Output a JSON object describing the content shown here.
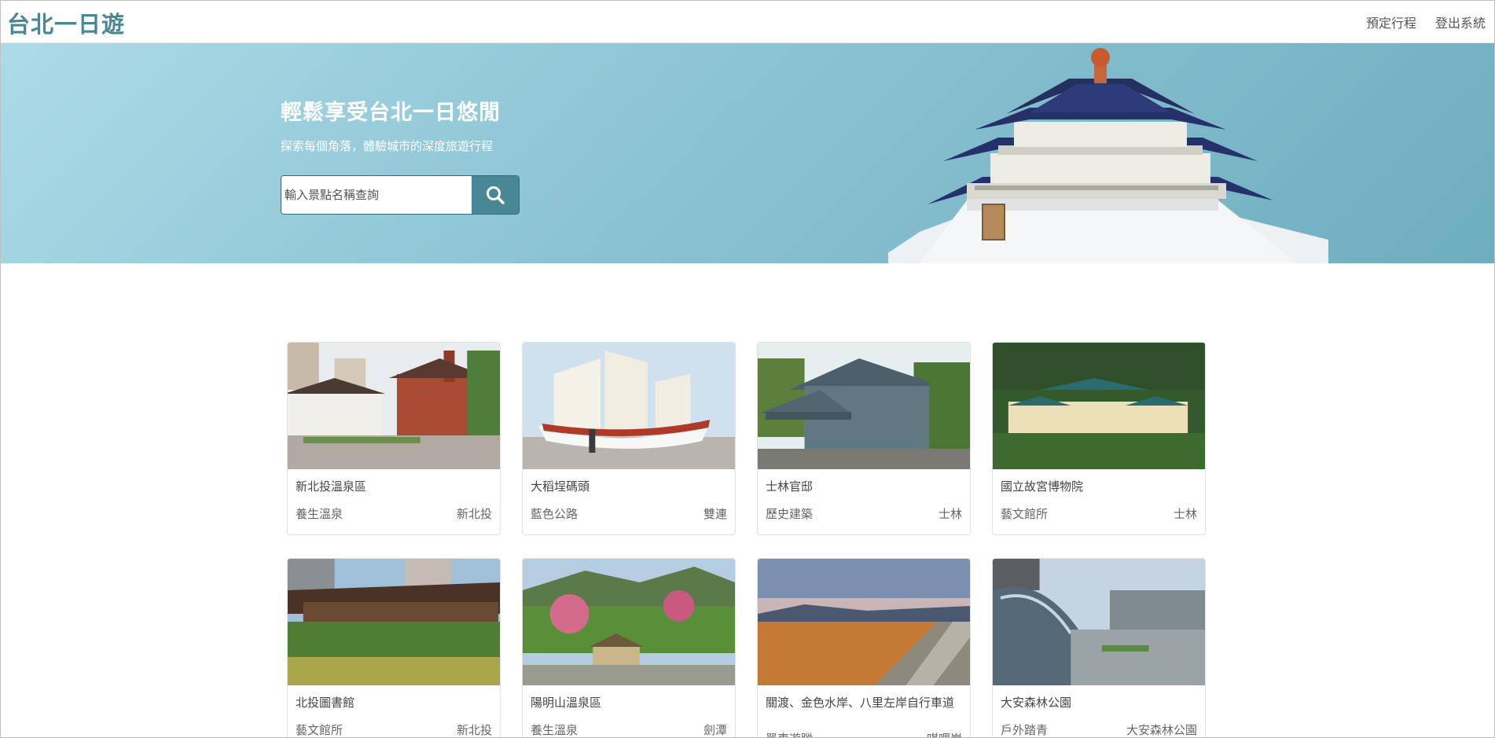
{
  "navbar": {
    "brand": "台北一日遊",
    "links": [
      "預定行程",
      "登出系統"
    ]
  },
  "hero": {
    "title": "輕鬆享受台北一日悠閒",
    "subtitle": "探索每個角落，體驗城市的深度旅遊行程",
    "search_placeholder": "輸入景點名稱查詢",
    "search_icon": "search-icon"
  },
  "attractions": [
    {
      "name": "新北投溫泉區",
      "category": "養生溫泉",
      "mrt": "新北投"
    },
    {
      "name": "大稻埕碼頭",
      "category": "藍色公路",
      "mrt": "雙連"
    },
    {
      "name": "士林官邸",
      "category": "歷史建築",
      "mrt": "士林"
    },
    {
      "name": "國立故宮博物院",
      "category": "藝文館所",
      "mrt": "士林"
    },
    {
      "name": "北投圖書館",
      "category": "藝文館所",
      "mrt": "新北投"
    },
    {
      "name": "陽明山溫泉區",
      "category": "養生溫泉",
      "mrt": "劍潭"
    },
    {
      "name": "關渡、金色水岸、八里左岸自行車道",
      "category": "單車遊蹤",
      "mrt": "唭哩岸"
    },
    {
      "name": "大安森林公園",
      "category": "戶外踏青",
      "mrt": "大安森林公園"
    }
  ]
}
